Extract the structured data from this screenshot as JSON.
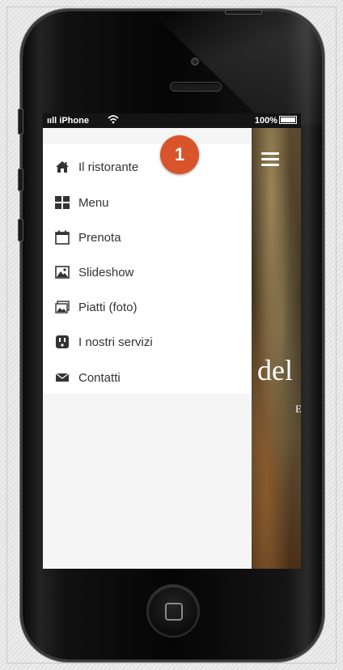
{
  "status_bar": {
    "carrier": "iPhone",
    "battery": "100%"
  },
  "menu": {
    "items": [
      {
        "label": "Il ristorante",
        "icon": "home-icon"
      },
      {
        "label": "Menu",
        "icon": "grid-icon"
      },
      {
        "label": "Prenota",
        "icon": "calendar-icon"
      },
      {
        "label": "Slideshow",
        "icon": "image-icon"
      },
      {
        "label": "Piatti (foto)",
        "icon": "photos-icon"
      },
      {
        "label": "I nostri servizi",
        "icon": "plug-icon"
      },
      {
        "label": "Contatti",
        "icon": "envelope-icon"
      }
    ]
  },
  "background": {
    "title_fragment": "del",
    "subtitle_fragment": "E"
  },
  "annotation": {
    "badge_number": "1",
    "color": "#d9532b"
  }
}
